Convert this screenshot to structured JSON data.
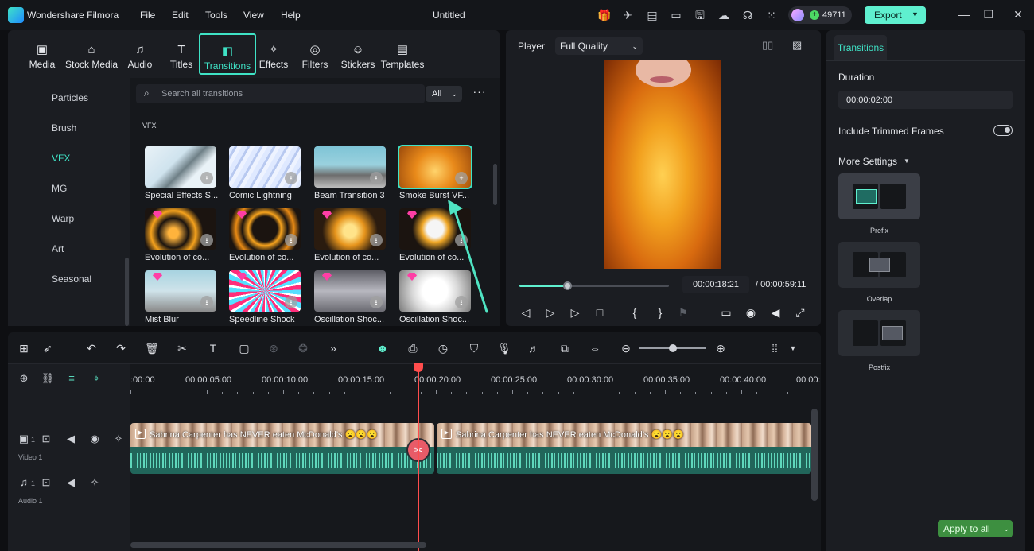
{
  "app": {
    "name": "Wondershare Filmora",
    "doc_title": "Untitled",
    "credits": "49711",
    "export_label": "Export"
  },
  "menu": [
    "File",
    "Edit",
    "Tools",
    "View",
    "Help"
  ],
  "categories": [
    {
      "label": "Media",
      "icon": "media-icon"
    },
    {
      "label": "Stock Media",
      "icon": "stock-media-icon"
    },
    {
      "label": "Audio",
      "icon": "audio-icon"
    },
    {
      "label": "Titles",
      "icon": "titles-icon"
    },
    {
      "label": "Transitions",
      "icon": "transitions-icon"
    },
    {
      "label": "Effects",
      "icon": "effects-icon"
    },
    {
      "label": "Filters",
      "icon": "filters-icon"
    },
    {
      "label": "Stickers",
      "icon": "stickers-icon"
    },
    {
      "label": "Templates",
      "icon": "templates-icon"
    }
  ],
  "sidebar": [
    "Particles",
    "Brush",
    "VFX",
    "MG",
    "Warp",
    "Art",
    "Seasonal"
  ],
  "sidebar_active": "VFX",
  "search": {
    "placeholder": "Search all transitions",
    "filter": "All"
  },
  "section": "VFX",
  "transitions": [
    {
      "label": "Special Effects S...",
      "premium": false,
      "selected": false
    },
    {
      "label": "Comic Lightning",
      "premium": false,
      "selected": false
    },
    {
      "label": "Beam Transition 3",
      "premium": false,
      "selected": false
    },
    {
      "label": "Smoke Burst VF...",
      "premium": false,
      "selected": true
    },
    {
      "label": "Evolution of co...",
      "premium": true,
      "selected": false
    },
    {
      "label": "Evolution of co...",
      "premium": true,
      "selected": false
    },
    {
      "label": "Evolution of co...",
      "premium": true,
      "selected": false
    },
    {
      "label": "Evolution of co...",
      "premium": true,
      "selected": false
    },
    {
      "label": "Mist Blur",
      "premium": true,
      "selected": false
    },
    {
      "label": "Speedline Shock",
      "premium": true,
      "selected": false
    },
    {
      "label": "Oscillation Shoc...",
      "premium": true,
      "selected": false
    },
    {
      "label": "Oscillation Shoc...",
      "premium": true,
      "selected": false
    }
  ],
  "player": {
    "label": "Player",
    "quality": "Full Quality",
    "current_time": "00:00:18:21",
    "total_time": "/ 00:00:59:11",
    "progress": 0.32
  },
  "properties": {
    "tab": "Transitions",
    "duration_label": "Duration",
    "duration_value": "00:00:02:00",
    "include_trimmed": "Include Trimmed Frames",
    "more_settings": "More Settings",
    "modes": [
      "Prefix",
      "Overlap",
      "Postfix"
    ],
    "selected_mode": "Prefix",
    "apply_all": "Apply to all"
  },
  "timeline": {
    "ticks": [
      ":00:00",
      "00:00:05:00",
      "00:00:10:00",
      "00:00:15:00",
      "00:00:20:00",
      "00:00:25:00",
      "00:00:30:00",
      "00:00:35:00",
      "00:00:40:00",
      "00:00:"
    ],
    "tracks": [
      {
        "name": "Video 1",
        "number": "1"
      },
      {
        "name": "Audio 1",
        "number": "1"
      }
    ],
    "clips": [
      {
        "title": "Sabrina Carpenter has NEVER eaten McDonald’s 😮😮😮"
      },
      {
        "title": "Sabrina Carpenter has NEVER eaten McDonald’s 😮😮😮"
      }
    ]
  },
  "colors": {
    "accent": "#5ff0cf",
    "playhead": "#ff4d4d",
    "premium": "#ff3ea5"
  }
}
